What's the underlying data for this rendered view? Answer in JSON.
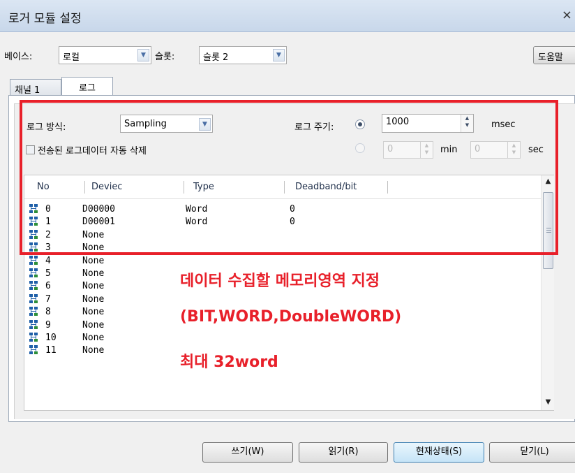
{
  "window": {
    "title": "로거 모듈 설정",
    "close": "×"
  },
  "top": {
    "base_label": "베이스:",
    "base_value": "로컬",
    "slot_label": "슬롯:",
    "slot_value": "슬롯 2",
    "help_label": "도움말"
  },
  "tabs": [
    {
      "label": "채널 1"
    },
    {
      "label": "로그"
    }
  ],
  "log": {
    "method_label": "로그 방식:",
    "method_value": "Sampling",
    "period_label": "로그 주기:",
    "period_value": "1000",
    "period_unit": "msec",
    "auto_delete_label": "전송된 로그데이터 자동 삭제",
    "min_value": "0",
    "min_unit": "min",
    "sec_value": "0",
    "sec_unit": "sec"
  },
  "table": {
    "columns": [
      "No",
      "Deviec",
      "Type",
      "Deadband/bit"
    ],
    "rows": [
      {
        "no": "0",
        "device": "D00000",
        "type": "Word",
        "deadband": "0"
      },
      {
        "no": "1",
        "device": "D00001",
        "type": "Word",
        "deadband": "0"
      },
      {
        "no": "2",
        "device": "None",
        "type": "",
        "deadband": ""
      },
      {
        "no": "3",
        "device": "None",
        "type": "",
        "deadband": ""
      },
      {
        "no": "4",
        "device": "None",
        "type": "",
        "deadband": ""
      },
      {
        "no": "5",
        "device": "None",
        "type": "",
        "deadband": ""
      },
      {
        "no": "6",
        "device": "None",
        "type": "",
        "deadband": ""
      },
      {
        "no": "7",
        "device": "None",
        "type": "",
        "deadband": ""
      },
      {
        "no": "8",
        "device": "None",
        "type": "",
        "deadband": ""
      },
      {
        "no": "9",
        "device": "None",
        "type": "",
        "deadband": ""
      },
      {
        "no": "10",
        "device": "None",
        "type": "",
        "deadband": ""
      },
      {
        "no": "11",
        "device": "None",
        "type": "",
        "deadband": ""
      }
    ]
  },
  "annotation": {
    "line1": "데이터 수집할 메모리영역 지정",
    "line2": "(BIT,WORD,DoubleWORD)",
    "line3": "최대 32word",
    "color": "#e8202a"
  },
  "buttons": {
    "write": "쓰기(W)",
    "read": "읽기(R)",
    "status": "현재상태(S)",
    "close": "닫기(L)"
  },
  "icons": {
    "row_icon": "device-tree-icon",
    "dropdown": "chevron-down-icon"
  }
}
